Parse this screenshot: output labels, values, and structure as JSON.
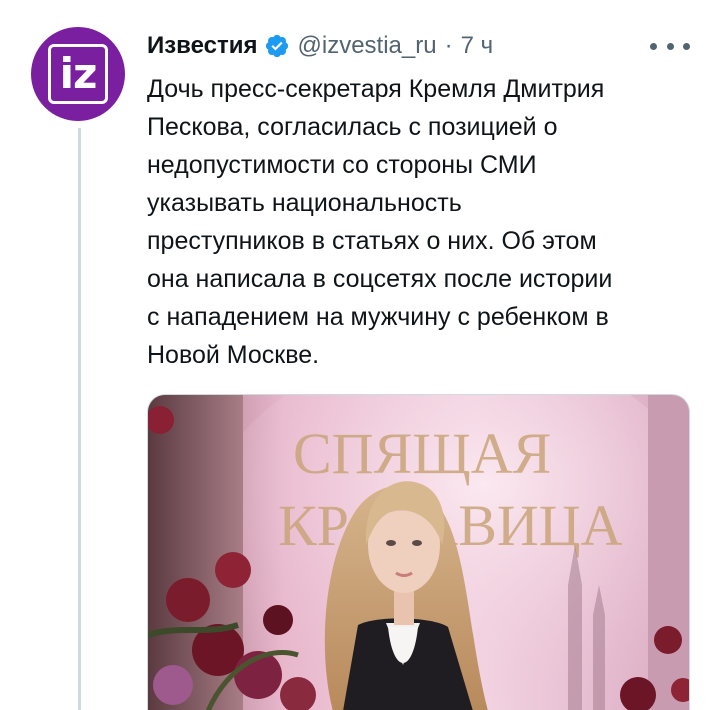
{
  "account": {
    "display_name": "Известия",
    "handle": "@izvestia_ru",
    "separator": "·",
    "time_ago": "7 ч",
    "avatar_text": "iz",
    "brand_color": "#7a1fa0",
    "verified_color": "#1d9bf0"
  },
  "tweet": {
    "text": "Дочь пресс-секретаря Кремля Дмитрия\nПескова, согласилась с позицией о\nнедопустимости со стороны СМИ\nуказывать национальность\nпреступников в статьях о них. Об этом\nона написала в соцсетях после истории\nс нападением на мужчину с ребенком в\nНовой Москве."
  },
  "media": {
    "sign_line_1": "СПЯЩАЯ",
    "sign_line_2": "КРАСАВИЦА"
  },
  "icons": {
    "verified": "verified-badge-icon",
    "more": "more-options-icon"
  }
}
